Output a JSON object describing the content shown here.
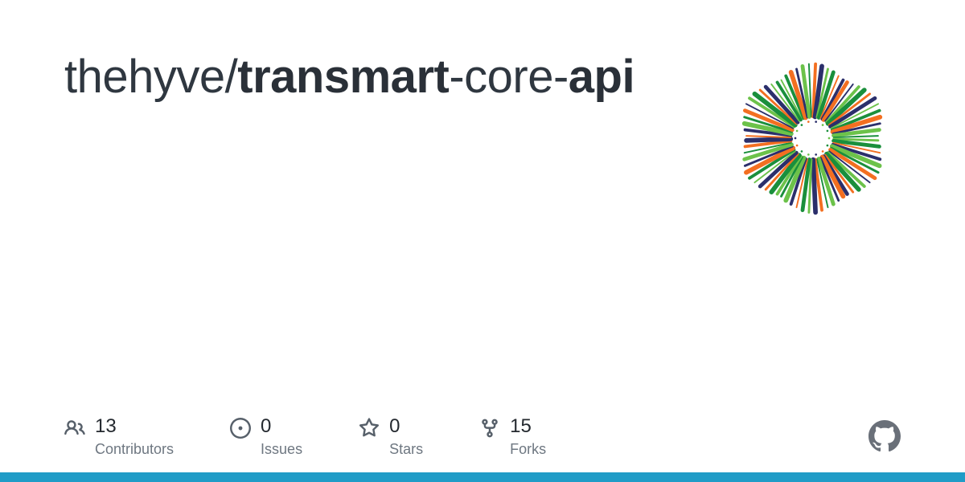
{
  "repo": {
    "owner": "thehyve",
    "slash": "/",
    "name_parts": [
      {
        "text": "transmart",
        "emph": true
      },
      {
        "text": "-core-",
        "emph": false
      },
      {
        "text": "api",
        "emph": true
      }
    ]
  },
  "stats": [
    {
      "icon": "people-icon",
      "value": "13",
      "label": "Contributors"
    },
    {
      "icon": "issue-icon",
      "value": "0",
      "label": "Issues"
    },
    {
      "icon": "star-icon",
      "value": "0",
      "label": "Stars"
    },
    {
      "icon": "fork-icon",
      "value": "15",
      "label": "Forks"
    }
  ],
  "colors": {
    "accent_bar": "#209cc7",
    "text_primary": "#24292f",
    "text_muted": "#6e7781"
  },
  "logo": {
    "name": "hexagonal-starburst-logo",
    "palette": [
      "#6cc24a",
      "#1a8f3c",
      "#f36f21",
      "#2b2f6b"
    ]
  }
}
